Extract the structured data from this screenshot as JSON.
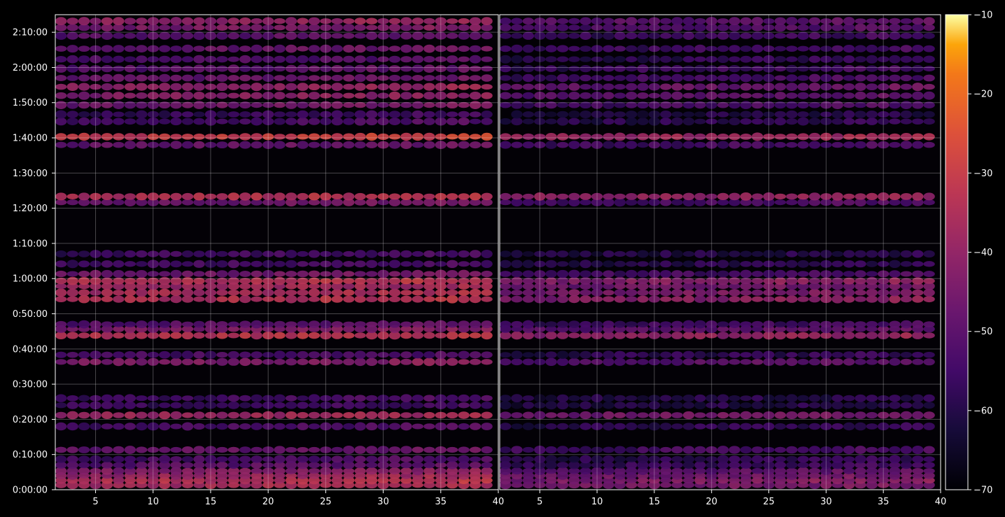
{
  "chart_data": {
    "type": "heatmap",
    "title": "",
    "xlabel": "",
    "ylabel": "",
    "panels": [
      {
        "name": "",
        "xlim": [
          1.5,
          40
        ],
        "x_ticks": [
          5,
          10,
          15,
          20,
          25,
          30,
          35,
          40
        ]
      },
      {
        "name": "",
        "xlim": [
          1.5,
          40
        ],
        "x_ticks": [
          5,
          10,
          15,
          20,
          25,
          30,
          35,
          40
        ]
      }
    ],
    "y_range_seconds": [
      0,
      8100
    ],
    "y_ticks": [
      {
        "value": 0,
        "label": "0:00:00"
      },
      {
        "value": 600,
        "label": "0:10:00"
      },
      {
        "value": 1200,
        "label": "0:20:00"
      },
      {
        "value": 1800,
        "label": "0:30:00"
      },
      {
        "value": 2400,
        "label": "0:40:00"
      },
      {
        "value": 3000,
        "label": "0:50:00"
      },
      {
        "value": 3600,
        "label": "1:00:00"
      },
      {
        "value": 4200,
        "label": "1:10:00"
      },
      {
        "value": 4800,
        "label": "1:20:00"
      },
      {
        "value": 5400,
        "label": "1:30:00"
      },
      {
        "value": 6000,
        "label": "1:40:00"
      },
      {
        "value": 6600,
        "label": "1:50:00"
      },
      {
        "value": 7200,
        "label": "2:00:00"
      },
      {
        "value": 7800,
        "label": "2:10:00"
      }
    ],
    "grid": true,
    "colormap": "inferno",
    "colorbar": {
      "range": [
        -70,
        -10
      ],
      "ticks": [
        {
          "value": -10,
          "label": "−10"
        },
        {
          "value": -20,
          "label": "−20"
        },
        {
          "value": -30,
          "label": "−30"
        },
        {
          "value": -40,
          "label": "−40"
        },
        {
          "value": -50,
          "label": "−50"
        },
        {
          "value": -60,
          "label": "−60"
        },
        {
          "value": -70,
          "label": "−70"
        }
      ]
    },
    "bands": [
      {
        "t": 80,
        "levels": [
          -38,
          -47
        ],
        "strong_panel": 0
      },
      {
        "t": 160,
        "levels": [
          -36,
          -45
        ],
        "strong_panel": 0
      },
      {
        "t": 240,
        "levels": [
          -40,
          -48
        ],
        "strong_panel": 0
      },
      {
        "t": 320,
        "levels": [
          -44,
          -52
        ],
        "strong_panel": 0
      },
      {
        "t": 420,
        "levels": [
          -52,
          -58
        ],
        "strong_panel": 0
      },
      {
        "t": 520,
        "levels": [
          -55,
          -60
        ],
        "strong_panel": 0
      },
      {
        "t": 680,
        "levels": [
          -50,
          -56
        ],
        "strong_panel": 0
      },
      {
        "t": 1080,
        "levels": [
          -55,
          -60
        ],
        "strong_panel": 0
      },
      {
        "t": 1270,
        "levels": [
          -40,
          -48
        ],
        "strong_panel": 0
      },
      {
        "t": 1440,
        "levels": [
          -57,
          -62
        ],
        "strong_panel": 0
      },
      {
        "t": 1560,
        "levels": [
          -56,
          -62
        ],
        "strong_panel": 0
      },
      {
        "t": 2180,
        "levels": [
          -45,
          -52
        ],
        "strong_panel": 0
      },
      {
        "t": 2300,
        "levels": [
          -55,
          -60
        ],
        "strong_panel": 0
      },
      {
        "t": 2630,
        "levels": [
          -35,
          -42
        ],
        "strong_panel": 0
      },
      {
        "t": 2740,
        "levels": [
          -46,
          -52
        ],
        "strong_panel": 0
      },
      {
        "t": 2820,
        "levels": [
          -52,
          -57
        ],
        "strong_panel": 0
      },
      {
        "t": 3250,
        "levels": [
          -36,
          -44
        ],
        "strong_panel": 0
      },
      {
        "t": 3360,
        "levels": [
          -38,
          -46
        ],
        "strong_panel": 0
      },
      {
        "t": 3470,
        "levels": [
          -40,
          -48
        ],
        "strong_panel": 0
      },
      {
        "t": 3560,
        "levels": [
          -36,
          -44
        ],
        "strong_panel": 0
      },
      {
        "t": 3680,
        "levels": [
          -48,
          -56
        ],
        "strong_panel": 0
      },
      {
        "t": 3850,
        "levels": [
          -56,
          -61
        ],
        "strong_panel": 0
      },
      {
        "t": 4020,
        "levels": [
          -57,
          -62
        ],
        "strong_panel": 0
      },
      {
        "t": 4900,
        "levels": [
          -48,
          -55
        ],
        "strong_panel": 0
      },
      {
        "t": 5000,
        "levels": [
          -36,
          -42
        ],
        "strong_panel": 0
      },
      {
        "t": 5880,
        "levels": [
          -50,
          -56
        ],
        "strong_panel": 0
      },
      {
        "t": 6020,
        "levels": [
          -32,
          -40
        ],
        "strong_panel": 0
      },
      {
        "t": 6280,
        "levels": [
          -55,
          -60
        ],
        "strong_panel": 0
      },
      {
        "t": 6400,
        "levels": [
          -58,
          -63
        ],
        "strong_panel": 0
      },
      {
        "t": 6560,
        "levels": [
          -48,
          -55
        ],
        "strong_panel": 0
      },
      {
        "t": 6720,
        "levels": [
          -44,
          -52
        ],
        "strong_panel": 0
      },
      {
        "t": 6870,
        "levels": [
          -42,
          -50
        ],
        "strong_panel": 0
      },
      {
        "t": 7020,
        "levels": [
          -50,
          -56
        ],
        "strong_panel": 0
      },
      {
        "t": 7180,
        "levels": [
          -52,
          -58
        ],
        "strong_panel": 0
      },
      {
        "t": 7340,
        "levels": [
          -54,
          -60
        ],
        "strong_panel": 0
      },
      {
        "t": 7520,
        "levels": [
          -50,
          -57
        ],
        "strong_panel": 0
      },
      {
        "t": 7740,
        "levels": [
          -52,
          -58
        ],
        "strong_panel": 0
      },
      {
        "t": 7880,
        "levels": [
          -46,
          -54
        ],
        "strong_panel": 0
      },
      {
        "t": 7990,
        "levels": [
          -42,
          -52
        ],
        "strong_panel": 0
      }
    ]
  }
}
